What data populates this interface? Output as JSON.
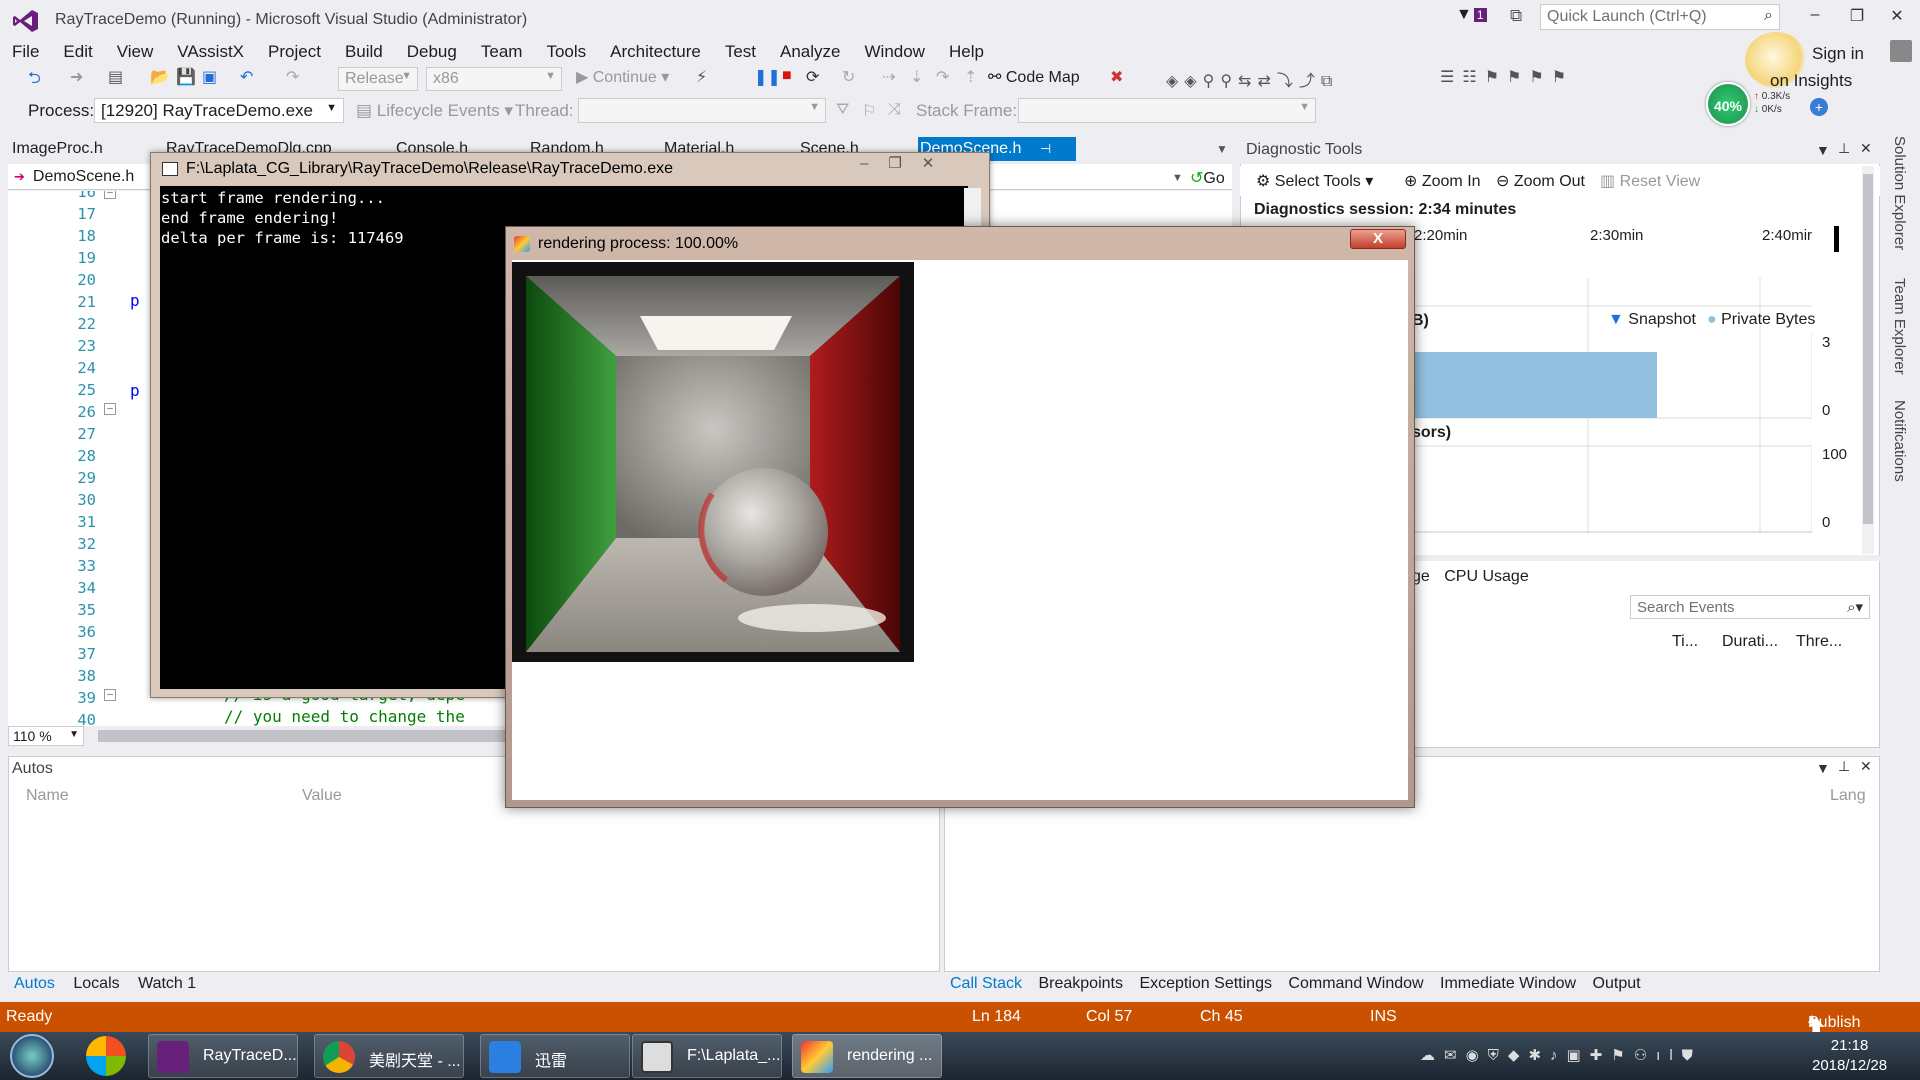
{
  "window": {
    "title": "RayTraceDemo (Running) - Microsoft Visual Studio (Administrator)",
    "quick_launch_placeholder": "Quick Launch (Ctrl+Q)",
    "flag_count": "1",
    "sign_in": "Sign in"
  },
  "menu": [
    "File",
    "Edit",
    "View",
    "VAssistX",
    "Project",
    "Build",
    "Debug",
    "Team",
    "Tools",
    "Architecture",
    "Test",
    "Analyze",
    "Window",
    "Help"
  ],
  "toolbar": {
    "config": "Release",
    "platform": "x86",
    "continue": "Continue",
    "code_map": "Code Map",
    "insights": "on Insights"
  },
  "debug_bar": {
    "process_label": "Process:",
    "process_value": "[12920] RayTraceDemo.exe",
    "lifecycle": "Lifecycle Events",
    "thread_label": "Thread:",
    "stack_frame_label": "Stack Frame:"
  },
  "perf": {
    "percent": "40%",
    "up": "0.3K/s",
    "down": "0K/s"
  },
  "doc_tabs": {
    "left_tab": "ImageProc.h",
    "items": [
      "RayTraceDemoDlg.cpp",
      "Console.h",
      "Random.h",
      "Material.h",
      "Scene.h"
    ],
    "active": "DemoScene.h",
    "nav_crumb": "DemoScene.h",
    "go": "Go"
  },
  "editor": {
    "line_numbers": [
      "16",
      "17",
      "18",
      "19",
      "20",
      "21",
      "22",
      "23",
      "24",
      "25",
      "26",
      "27",
      "28",
      "29",
      "30",
      "31",
      "32",
      "33",
      "34",
      "35",
      "36",
      "37",
      "38",
      "39",
      "40"
    ],
    "line_39": "// is a good target, depe",
    "line_40": "// you need to change the",
    "zoom": "110 %"
  },
  "console": {
    "title": "F:\\Laplata_CG_Library\\RayTraceDemo\\Release\\RayTraceDemo.exe",
    "lines": "start frame rendering...\nend frame endering!\ndelta per frame is: 117469"
  },
  "render_window": {
    "title": "rendering process: 100.00%",
    "close": "X"
  },
  "diagnostic": {
    "title": "Diagnostic Tools",
    "select_tools": "Select Tools",
    "zoom_in": "Zoom In",
    "zoom_out": "Zoom Out",
    "reset_view": "Reset View",
    "session": "Diagnostics session: 2:34 minutes",
    "ticks": [
      "2:20min",
      "2:30min",
      "2:40mir"
    ],
    "memory_label": "B)",
    "snapshot": "Snapshot",
    "private_bytes": "Private Bytes",
    "mem_axis_top": "3",
    "mem_axis_bottom": "0",
    "cpu_label": "sors)",
    "cpu_axis_top": "100",
    "cpu_axis_bottom": "0",
    "tab_partial": "ge",
    "cpu_usage": "CPU Usage",
    "search_placeholder": "Search Events",
    "columns": [
      "Ti...",
      "Durati...",
      "Thre..."
    ]
  },
  "side_tabs": [
    "Solution Explorer",
    "Team Explorer",
    "Notifications"
  ],
  "autos": {
    "title": "Autos",
    "col_name": "Name",
    "col_value": "Value",
    "tabs": [
      "Autos",
      "Locals",
      "Watch 1"
    ]
  },
  "callstack": {
    "col_lang": "Lang",
    "tabs": [
      "Call Stack",
      "Breakpoints",
      "Exception Settings",
      "Command Window",
      "Immediate Window",
      "Output"
    ]
  },
  "statusbar": {
    "ready": "Ready",
    "ln": "Ln 184",
    "col": "Col 57",
    "ch": "Ch 45",
    "ins": "INS",
    "publish": "Publish"
  },
  "taskbar": {
    "items": [
      "RayTraceD...",
      "美剧天堂 - ...",
      "迅雷",
      "F:\\Laplata_...",
      "rendering ..."
    ],
    "time": "21:18",
    "date": "2018/12/28"
  },
  "colors": {
    "accent": "#007acc",
    "status_debug": "#ca5100",
    "memory_bar": "#92c1e0"
  }
}
